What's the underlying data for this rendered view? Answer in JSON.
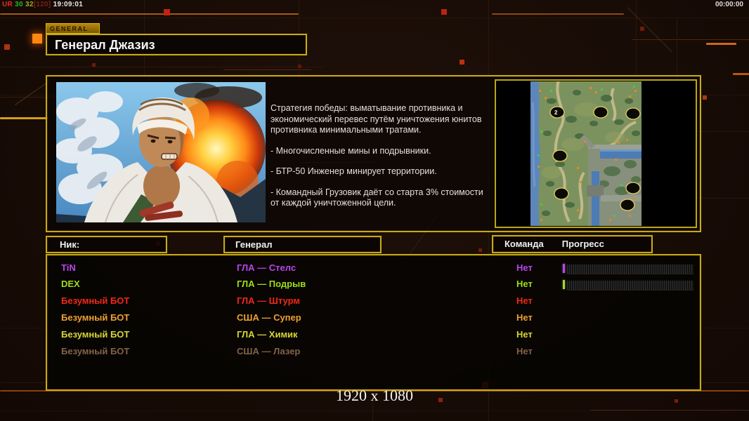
{
  "topbar": {
    "debug_ur": "UR",
    "debug_v1": "30",
    "debug_v2": "32",
    "debug_bracket": "[120]",
    "debug_clock": "19:09:01",
    "timer": "00:00:00"
  },
  "header": {
    "tab_label": "GENERAL",
    "title": "Генерал Джазиз"
  },
  "strategy": {
    "p1": "Стратегия победы: выматывание противника и экономический перевес путём уничтожения юнитов противника минимальными тратами.",
    "p2": "- Многочисленные мины и подрывники.",
    "p3": "- БТР-50 Инженер минирует территории.",
    "p4": "- Командный Грузовик даёт со старта 3% стоимости от каждой уничтоженной цели."
  },
  "minimap": {
    "marker": "2"
  },
  "table": {
    "headers": {
      "nick": "Ник:",
      "general": "Генерал",
      "team": "Команда",
      "progress": "Прогресс"
    },
    "rows": [
      {
        "nick": "TiN",
        "general": "ГЛА — Стелс",
        "team": "Нет",
        "color": "#bb44ee",
        "has_bar": true
      },
      {
        "nick": "DEX",
        "general": "ГЛА — Подрыв",
        "team": "Нет",
        "color": "#9ede18",
        "has_bar": true
      },
      {
        "nick": "Безумный БОТ",
        "general": "ГЛА — Штурм",
        "team": "Нет",
        "color": "#f22818",
        "has_bar": false
      },
      {
        "nick": "Безумный БОТ",
        "general": "США — Супер",
        "team": "Нет",
        "color": "#eea034",
        "has_bar": false
      },
      {
        "nick": "Безумный БОТ",
        "general": "ГЛА — Химик",
        "team": "Нет",
        "color": "#d6d636",
        "has_bar": false
      },
      {
        "nick": "Безумный БОТ",
        "general": "США — Лазер",
        "team": "Нет",
        "color": "#84614a",
        "has_bar": false
      }
    ]
  },
  "footer": {
    "resolution": "1920 x 1080"
  },
  "colors": {
    "accent_border": "#c2ae12",
    "circuit_orange": "#c8641a",
    "circuit_red": "#cc2410",
    "background": "#180c06"
  }
}
